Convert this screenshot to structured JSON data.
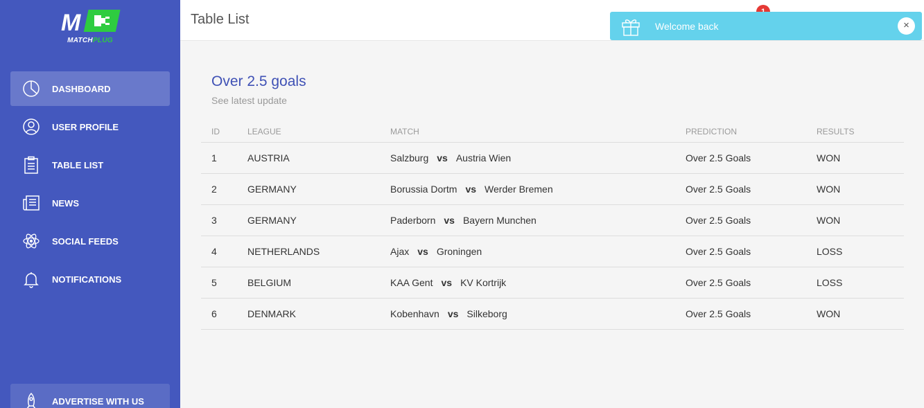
{
  "brand": {
    "logo_mark": "M",
    "logo_text_1": "MATCH",
    "logo_text_2": "PLUG"
  },
  "sidebar": {
    "items": [
      {
        "label": "DASHBOARD",
        "icon": "pie-chart-icon",
        "active": true
      },
      {
        "label": "USER PROFILE",
        "icon": "user-icon"
      },
      {
        "label": "TABLE LIST",
        "icon": "clipboard-icon"
      },
      {
        "label": "NEWS",
        "icon": "newspaper-icon"
      },
      {
        "label": "SOCIAL FEEDS",
        "icon": "atom-icon"
      },
      {
        "label": "NOTIFICATIONS",
        "icon": "bell-icon"
      }
    ],
    "advertise": {
      "label": "ADVERTISE WITH US",
      "icon": "rocket-icon"
    }
  },
  "header": {
    "title": "Table List",
    "notification_count": "1"
  },
  "toast": {
    "message": "Welcome back",
    "icon": "gift-icon",
    "close": "×",
    "color": "#64d2ec"
  },
  "card": {
    "title": "Over 2.5 goals",
    "subtitle": "See latest update"
  },
  "table": {
    "columns": [
      "ID",
      "LEAGUE",
      "MATCH",
      "PREDICTION",
      "RESULTS"
    ],
    "vs_label": "vs",
    "rows": [
      {
        "id": "1",
        "league": "AUSTRIA",
        "home": "Salzburg",
        "away": "Austria Wien",
        "prediction": "Over 2.5 Goals",
        "result": "WON"
      },
      {
        "id": "2",
        "league": "GERMANY",
        "home": "Borussia Dortm",
        "away": "Werder Bremen",
        "prediction": "Over 2.5 Goals",
        "result": "WON"
      },
      {
        "id": "3",
        "league": "GERMANY",
        "home": "Paderborn",
        "away": "Bayern Munchen",
        "prediction": "Over 2.5 Goals",
        "result": "WON"
      },
      {
        "id": "4",
        "league": "NETHERLANDS",
        "home": "Ajax",
        "away": "Groningen",
        "prediction": "Over 2.5 Goals",
        "result": "LOSS"
      },
      {
        "id": "5",
        "league": "BELGIUM",
        "home": "KAA Gent",
        "away": "KV Kortrijk",
        "prediction": "Over 2.5 Goals",
        "result": "LOSS"
      },
      {
        "id": "6",
        "league": "DENMARK",
        "home": "Kobenhavn",
        "away": "Silkeborg",
        "prediction": "Over 2.5 Goals",
        "result": "WON"
      }
    ]
  },
  "colors": {
    "sidebar": "#4458be",
    "accent": "#3f51b5",
    "badge": "#e53935",
    "logo_green": "#2ecc40"
  }
}
